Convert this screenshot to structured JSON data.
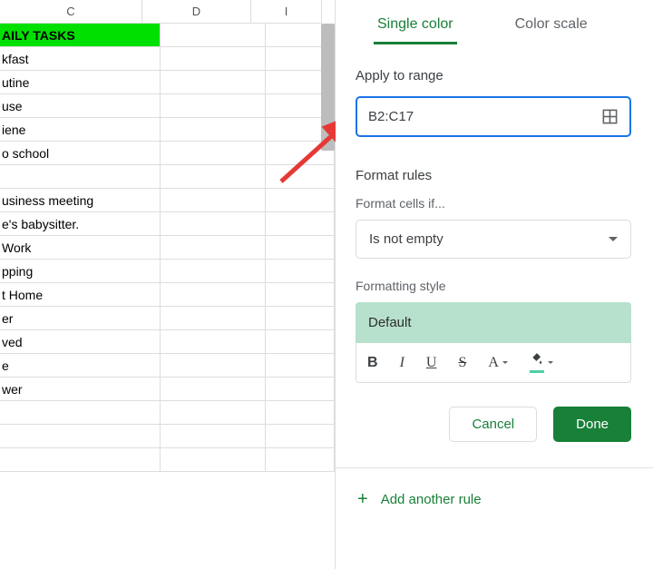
{
  "sheet": {
    "columns": [
      "C",
      "D",
      "I"
    ],
    "rows": [
      {
        "c": "AILY TASKS",
        "header": true
      },
      {
        "c": "kfast"
      },
      {
        "c": "utine"
      },
      {
        "c": "use"
      },
      {
        "c": "iene"
      },
      {
        "c": "o school"
      },
      {
        "c": ""
      },
      {
        "c": "usiness meeting"
      },
      {
        "c": "e's babysitter."
      },
      {
        "c": "Work"
      },
      {
        "c": "pping"
      },
      {
        "c": "t Home"
      },
      {
        "c": "er"
      },
      {
        "c": "ved"
      },
      {
        "c": "e"
      },
      {
        "c": "wer"
      },
      {
        "c": ""
      },
      {
        "c": ""
      },
      {
        "c": ""
      }
    ]
  },
  "panel": {
    "tabs": {
      "single": "Single color",
      "scale": "Color scale"
    },
    "apply_label": "Apply to range",
    "range_value": "B2:C17",
    "rules_label": "Format rules",
    "cells_if_label": "Format cells if...",
    "condition": "Is not empty",
    "style_label": "Formatting style",
    "style_preview": "Default",
    "toolbar": {
      "bold": "B",
      "italic": "I",
      "underline": "U",
      "strike": "S",
      "text": "A"
    },
    "cancel": "Cancel",
    "done": "Done",
    "add_rule": "Add another rule"
  }
}
